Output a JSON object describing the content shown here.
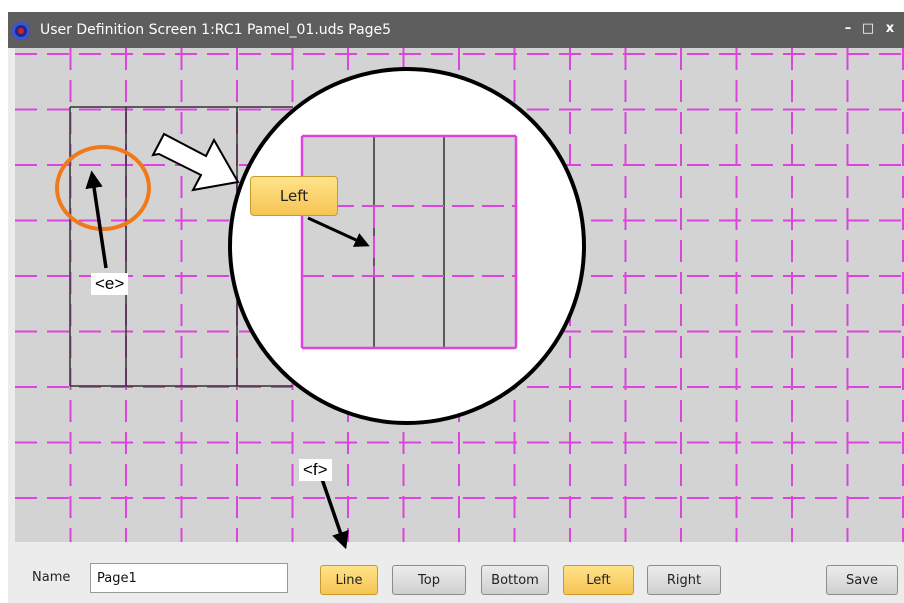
{
  "window": {
    "title": "User Definition Screen 1:RC1 Pamel_01.uds Page5",
    "controls": {
      "minimize": "–",
      "maximize": "□",
      "close": "x"
    }
  },
  "toolbar": {
    "name_label": "Name",
    "name_value": "Page1",
    "buttons": {
      "line": "Line",
      "top": "Top",
      "bottom": "Bottom",
      "left": "Left",
      "right": "Right",
      "save": "Save"
    },
    "active": [
      "Line",
      "Left"
    ]
  },
  "zoom": {
    "button_label": "Left"
  },
  "annotations": {
    "e": "<e>",
    "f": "<f>"
  },
  "colors": {
    "grid": "#dd44dd",
    "canvas": "#d3d3d3",
    "highlight": "#f5c04a",
    "circle_marker": "#f07a1a",
    "titlebar": "#5e5e5e"
  }
}
